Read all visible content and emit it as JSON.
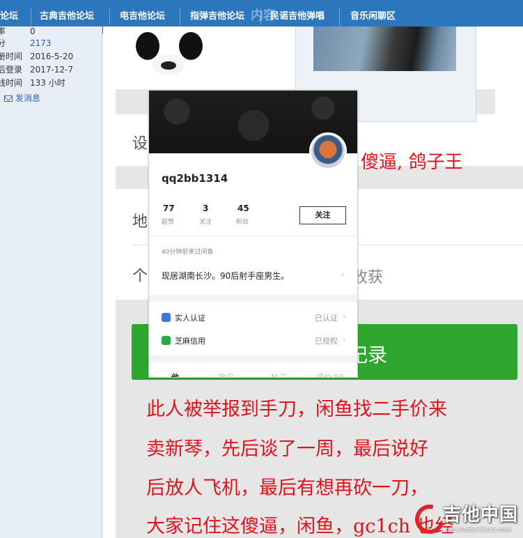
{
  "nav": {
    "items": [
      "论坛",
      "古典吉他论坛",
      "电吉他论坛",
      "指弹吉他论坛",
      "民谣吉他弹唱",
      "音乐闲聊区"
    ],
    "ghost_text": "内容"
  },
  "profile": {
    "rows": [
      {
        "key": "率",
        "value": "0"
      },
      {
        "key": "分",
        "value": "2173"
      },
      {
        "key": "册时间",
        "value": "2016-5-20"
      },
      {
        "key": "后登录",
        "value": "2017-12-7"
      },
      {
        "key": "线时间",
        "value": "133 小时"
      }
    ],
    "send_message": "发消息"
  },
  "background": {
    "fragment_1": "设",
    "fragment_2": "地",
    "fragment_3": "个",
    "fragment_4": "收获",
    "green_button_text": "纪录"
  },
  "card": {
    "username": "qq2bb1314",
    "stats": [
      {
        "value": "77",
        "label": "超赞"
      },
      {
        "value": "3",
        "label": "关注"
      },
      {
        "value": "45",
        "label": "粉丝"
      }
    ],
    "follow_label": "关注",
    "last_seen": "40分钟前来过闲鱼",
    "bio": "现居湖南长沙。90后射手座男生。",
    "verifications": [
      {
        "label": "实人认证",
        "status": "已认证",
        "color": "#3f76d8"
      },
      {
        "label": "芝麻信用",
        "status": "已授权",
        "color": "#2aa84a"
      }
    ],
    "tabs": [
      "他",
      "宝贝",
      "帖子",
      "评价 59"
    ]
  },
  "annotation": {
    "side": "傻逼, 鸽子王",
    "lines": [
      "此人被举报到手刀，闲鱼找二手价来",
      "卖新琴，先后谈了一周，最后说好",
      "后放人飞机，最后有想再砍一刀，",
      "大家记住这傻逼，闲鱼，gc1ch 也经"
    ]
  },
  "watermark": {
    "title": "吉他中国",
    "subtitle": "bbs.GuitarChina.com"
  },
  "colors": {
    "nav": "#2b76bd",
    "annotation_red": "#e0131c",
    "green_button": "#2ea52e"
  }
}
